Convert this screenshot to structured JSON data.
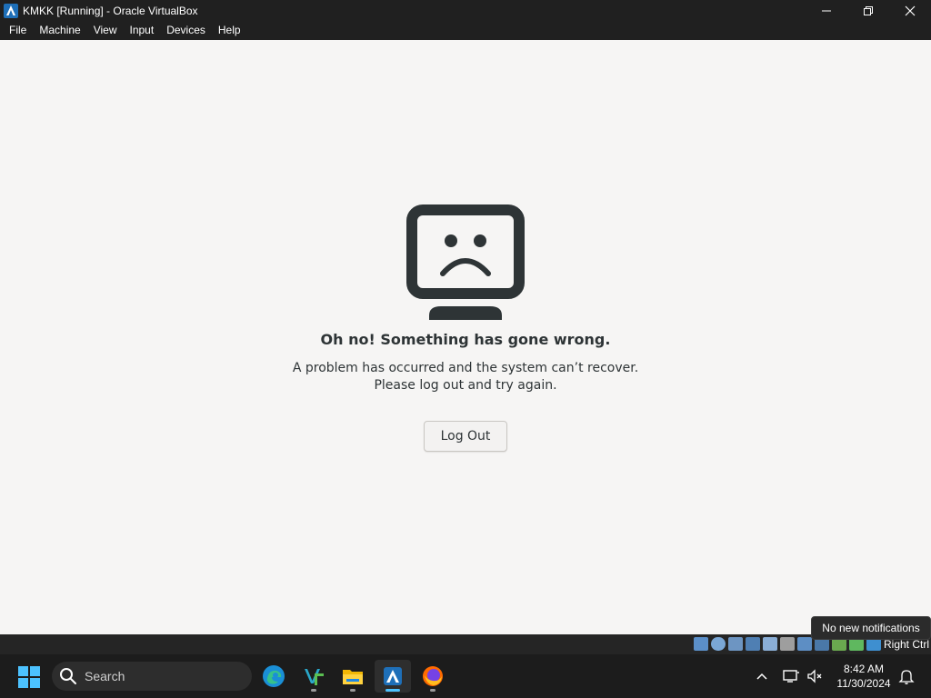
{
  "window": {
    "title": "KMKK [Running] - Oracle VirtualBox"
  },
  "menu": {
    "items": [
      "File",
      "Machine",
      "View",
      "Input",
      "Devices",
      "Help"
    ]
  },
  "guest": {
    "error_title": "Oh no!  Something has gone wrong.",
    "error_line1": "A problem has occurred and the system can’t recover.",
    "error_line2": "Please log out and try again.",
    "logout_label": "Log Out"
  },
  "vbox_status": {
    "host_key": "Right Ctrl"
  },
  "tooltip": {
    "text": "No new notifications"
  },
  "taskbar": {
    "search_placeholder": "Search",
    "apps": [
      "edge-icon",
      "visual-studio-icon",
      "file-explorer-icon",
      "virtualbox-icon",
      "firefox-icon"
    ],
    "time": "8:42 AM",
    "date": "11/30/2024"
  },
  "colors": {
    "guest_bg": "#f6f5f4",
    "title_bar": "#202020",
    "taskbar": "#1c1c1c",
    "accent": "#4cc2ff",
    "sad_icon": "#2e3436"
  }
}
